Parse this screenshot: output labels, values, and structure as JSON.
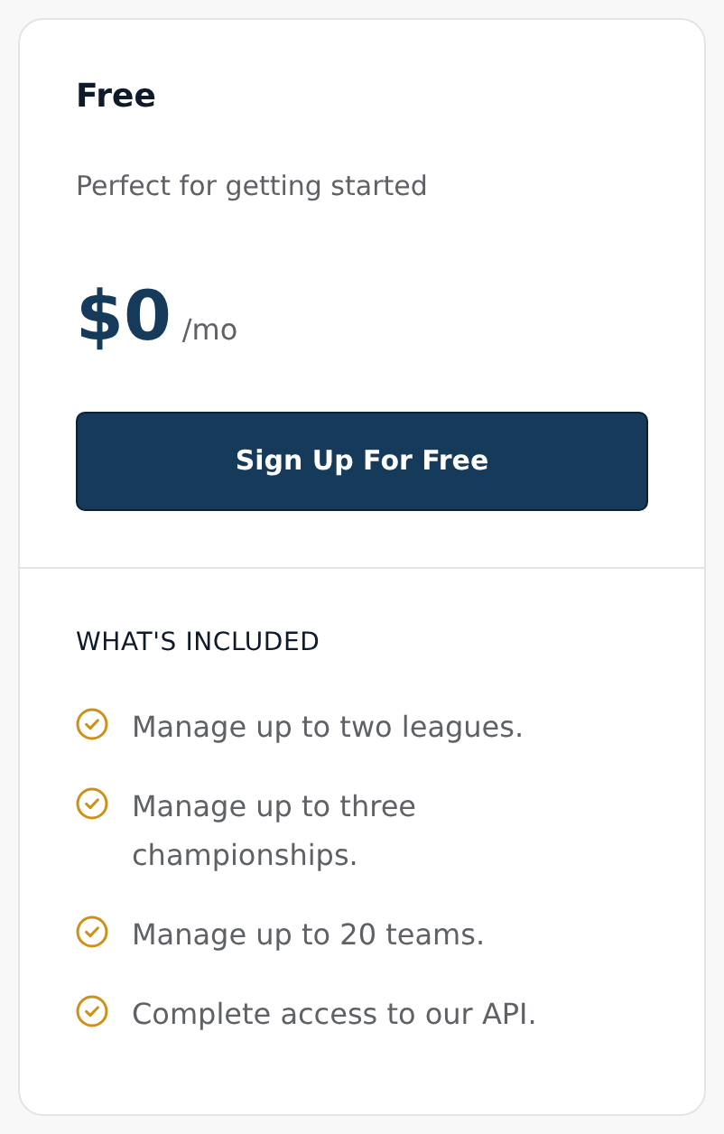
{
  "plan": {
    "name": "Free",
    "tagline": "Perfect for getting started",
    "price": "$0",
    "period": "/mo",
    "cta": "Sign Up For Free"
  },
  "included": {
    "heading": "WHAT'S INCLUDED",
    "features": [
      {
        "text": "Manage up to two leagues."
      },
      {
        "text": "Manage up to three championships."
      },
      {
        "text": "Manage up to 20 teams."
      },
      {
        "text": "Complete access to our API."
      }
    ]
  }
}
